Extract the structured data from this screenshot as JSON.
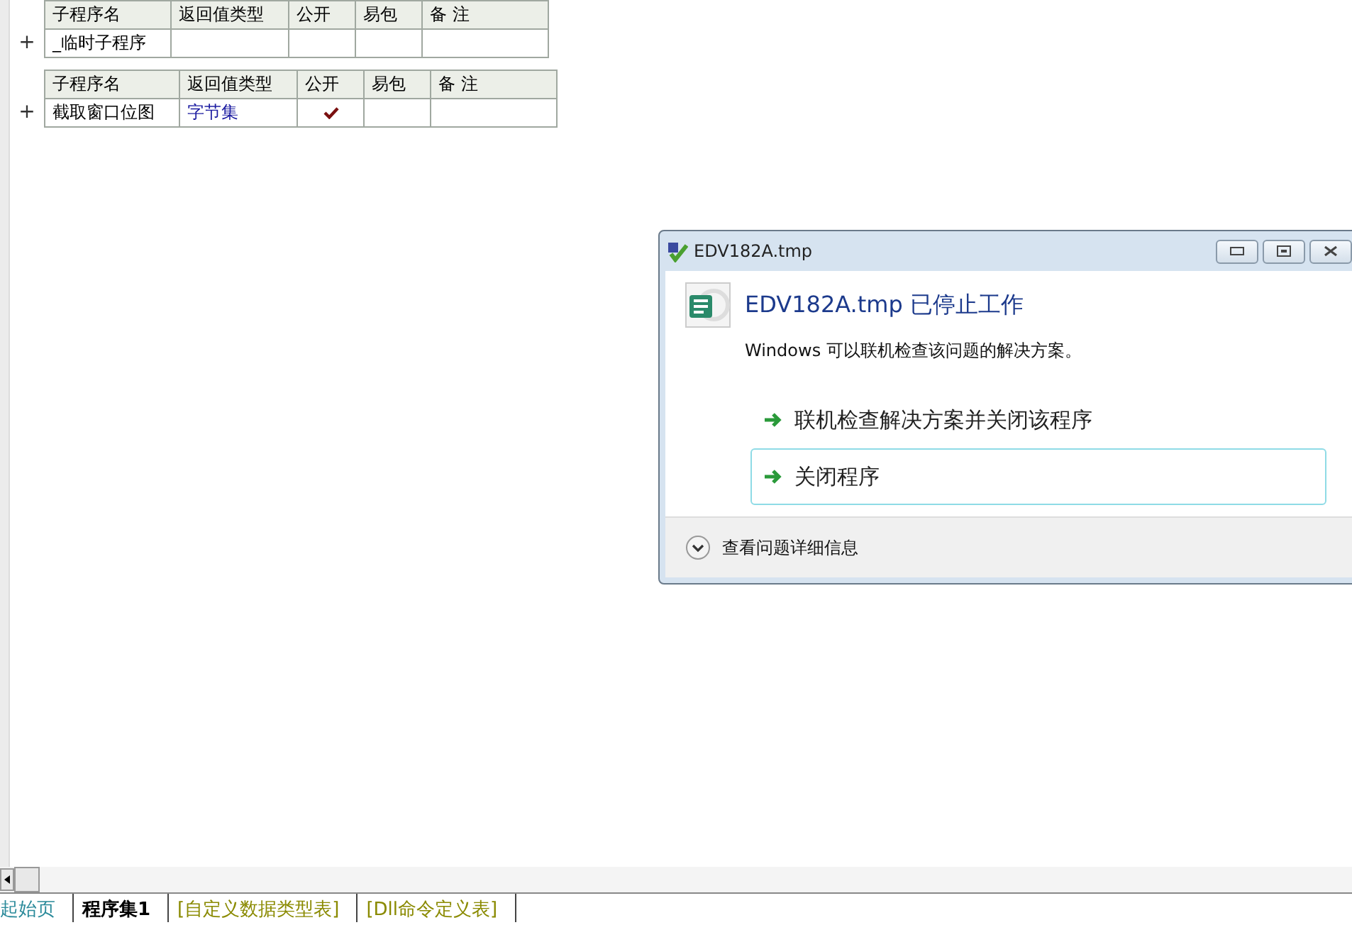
{
  "tables": [
    {
      "expand": "+",
      "columns": [
        "子程序名",
        "返回值类型",
        "公开",
        "易包",
        "备 注"
      ],
      "rows": [
        {
          "name": "_临时子程序",
          "return_type": "",
          "public": false,
          "easy_package": false,
          "remark": ""
        }
      ]
    },
    {
      "expand": "+",
      "columns": [
        "子程序名",
        "返回值类型",
        "公开",
        "易包",
        "备 注"
      ],
      "rows": [
        {
          "name": "截取窗口位图",
          "return_type": "字节集",
          "public": true,
          "easy_package": false,
          "remark": ""
        }
      ]
    }
  ],
  "dialog": {
    "title": "EDV182A.tmp",
    "heading": "EDV182A.tmp 已停止工作",
    "message": "Windows 可以联机检查该问题的解决方案。",
    "options": [
      {
        "label": "联机检查解决方案并关闭该程序",
        "selected": false
      },
      {
        "label": "关闭程序",
        "selected": true
      }
    ],
    "details": "查看问题详细信息"
  },
  "tabs": [
    {
      "label": "起始页",
      "kind": "start",
      "selected": false
    },
    {
      "label": "程序集1",
      "kind": "code",
      "selected": true
    },
    {
      "label": "[自定义数据类型表]",
      "kind": "table",
      "selected": false
    },
    {
      "label": "[Dll命令定义表]",
      "kind": "table",
      "selected": false
    }
  ]
}
